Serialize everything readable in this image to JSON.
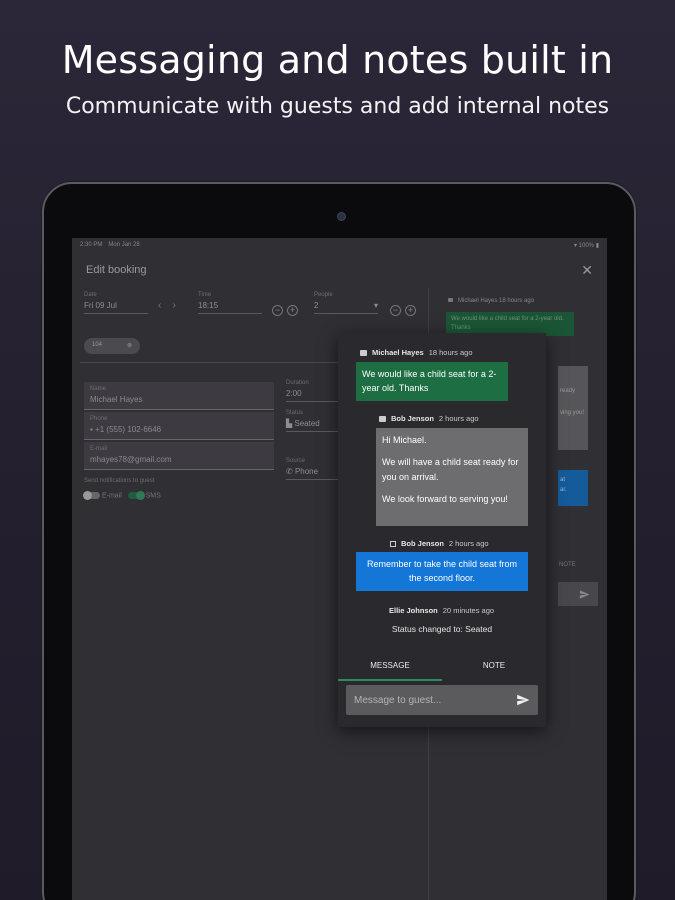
{
  "hero": {
    "title": "Messaging and notes built in",
    "subtitle": "Communicate with guests and add internal notes"
  },
  "statusbar": {
    "time": "2:30 PM",
    "date": "Mon Jan 28",
    "battery": "100%"
  },
  "appbar": {
    "title": "Edit booking",
    "close": "✕"
  },
  "form": {
    "date_label": "Date",
    "date_value": "Fri 09 Jul",
    "time_label": "Time",
    "time_value": "18:15",
    "people_label": "People",
    "people_value": "2",
    "chip": "104",
    "name_label": "Name",
    "name_value": "Michael Hayes",
    "phone_label": "Phone",
    "phone_value": "+1 (555) 102-6646",
    "email_label": "E-mail",
    "email_value": "mhayes78@gmail.com",
    "notify_label": "Send notifications to guest",
    "email_toggle": "E-mail",
    "sms_toggle": "SMS",
    "duration_label": "Duration",
    "duration_value": "2:00",
    "status_label": "Status",
    "status_value": "Seated",
    "source_label": "Source",
    "source_value": "Phone"
  },
  "background_chat": {
    "sender": "Michael Hayes",
    "time": "18 hours ago",
    "text": "We would like a child seat for a 2-year old. Thanks",
    "fragments": [
      "ready",
      "ving you!",
      "at",
      "ar.",
      "NOTE"
    ]
  },
  "popup": {
    "messages": [
      {
        "sender": "Michael Hayes",
        "time": "18 hours ago",
        "text": "We would like a child seat for a 2-year old. Thanks"
      },
      {
        "sender": "Bob Jenson",
        "time": "2 hours ago",
        "lines": [
          "Hi Michael.",
          "",
          "We will have a child seat ready for you on arrival.",
          "",
          "We look forward to serving you!"
        ]
      },
      {
        "sender": "Bob Jenson",
        "time": "2 hours ago",
        "text": "Remember to take the child seat from the second floor."
      }
    ],
    "status_meta": {
      "sender": "Ellie Johnson",
      "time": "20 minutes ago"
    },
    "status_text": "Status changed to: Seated",
    "tabs": [
      "MESSAGE",
      "NOTE"
    ],
    "input_placeholder": "Message to guest..."
  },
  "colors": {
    "green": "#1d6e42",
    "blue": "#1476d6",
    "grey": "#6d6d70",
    "accent": "#2b8a5f"
  }
}
